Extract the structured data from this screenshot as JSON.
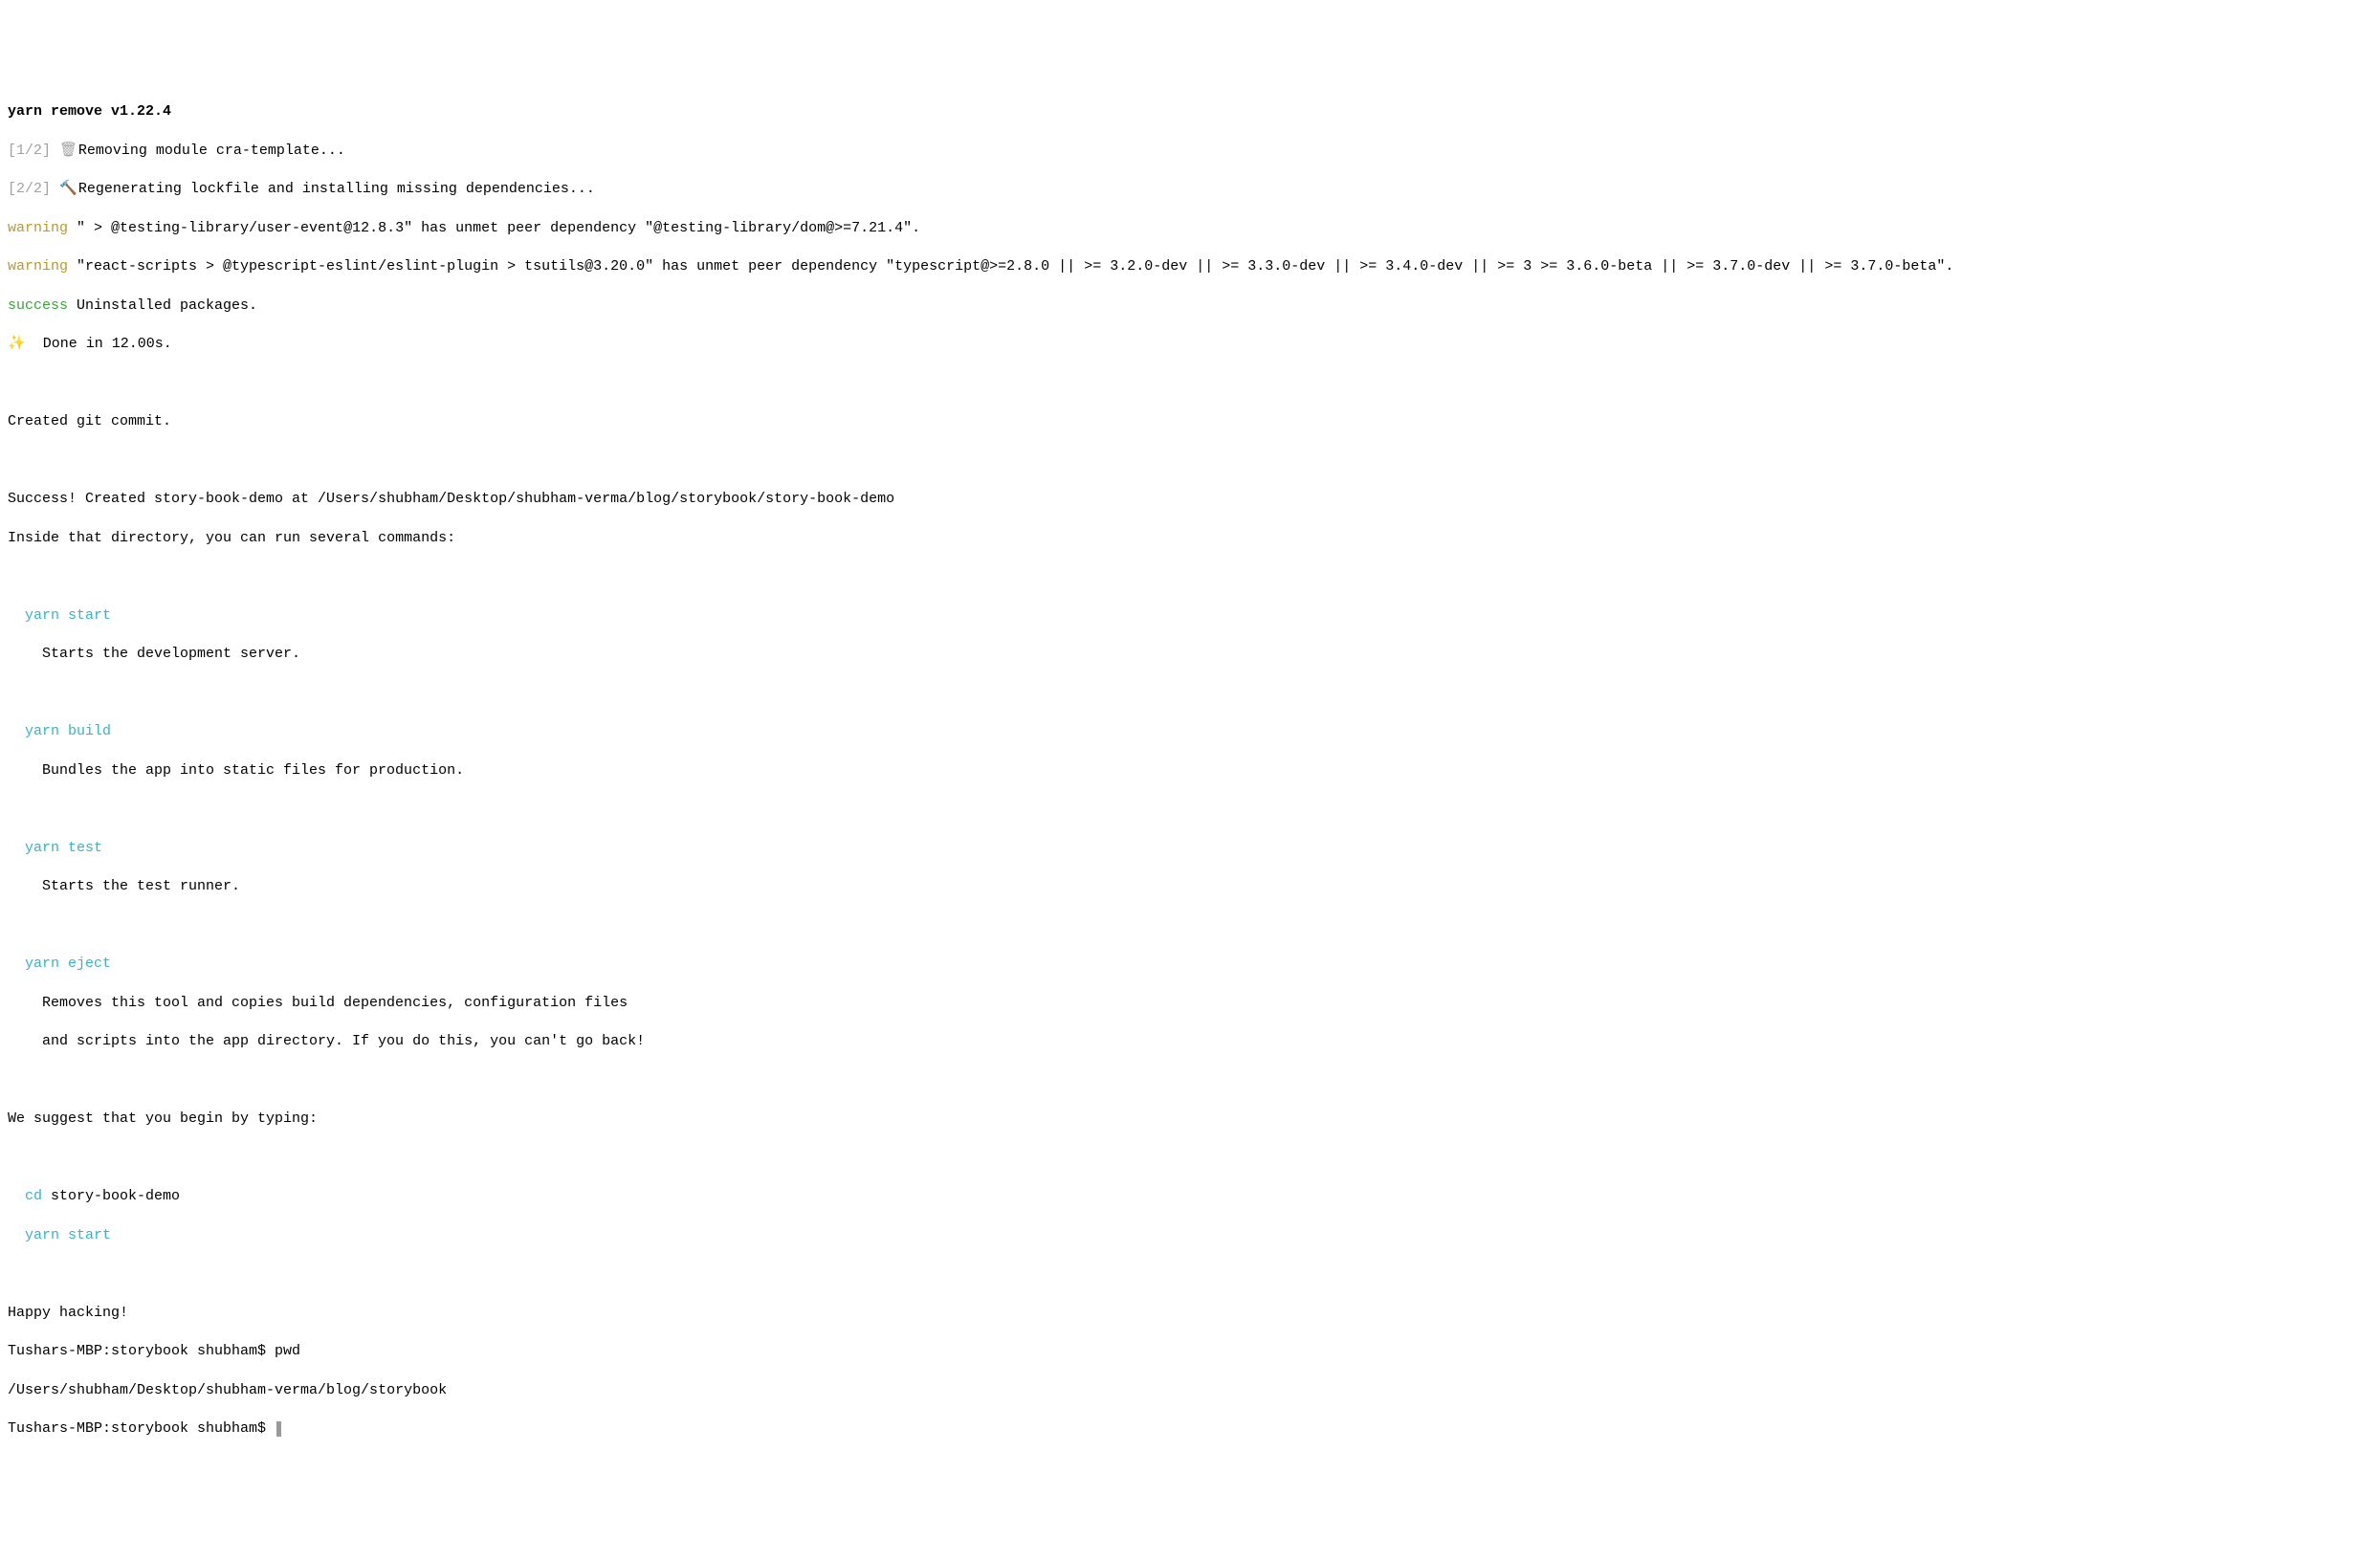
{
  "header": "yarn remove v1.22.4",
  "steps": [
    {
      "num": "[1/2]",
      "icon": "🗑",
      "text": " Removing module cra-template..."
    },
    {
      "num": "[2/2]",
      "icon": "🔨",
      "text": " Regenerating lockfile and installing missing dependencies..."
    }
  ],
  "warnings": [
    {
      "label": "warning",
      "text": " \" > @testing-library/user-event@12.8.3\" has unmet peer dependency \"@testing-library/dom@>=7.21.4\"."
    },
    {
      "label": "warning",
      "text": " \"react-scripts > @typescript-eslint/eslint-plugin > tsutils@3.20.0\" has unmet peer dependency \"typescript@>=2.8.0 || >= 3.2.0-dev || >= 3.3.0-dev || >= 3.4.0-dev || >= 3 >= 3.6.0-beta || >= 3.7.0-dev || >= 3.7.0-beta\"."
    }
  ],
  "successLine": {
    "label": "success",
    "text": " Uninstalled packages."
  },
  "doneLine": {
    "icon": "✨",
    "text": "  Done in 12.00s."
  },
  "gitCommit": "Created git commit.",
  "createdSuccess": "Success! Created story-book-demo at /Users/shubham/Desktop/shubham-verma/blog/storybook/story-book-demo",
  "insideDir": "Inside that directory, you can run several commands:",
  "commands": [
    {
      "name": "yarn start",
      "desc": [
        "Starts the development server."
      ]
    },
    {
      "name": "yarn build",
      "desc": [
        "Bundles the app into static files for production."
      ]
    },
    {
      "name": "yarn test",
      "desc": [
        "Starts the test runner."
      ]
    },
    {
      "name": "yarn eject",
      "desc": [
        "Removes this tool and copies build dependencies, configuration files",
        "and scripts into the app directory. If you do this, you can't go back!"
      ]
    }
  ],
  "suggest": "We suggest that you begin by typing:",
  "beginCd": {
    "cmd": "cd",
    "arg": " story-book-demo"
  },
  "beginStart": "yarn start",
  "happy": "Happy hacking!",
  "prompt1": {
    "ps": "Tushars-MBP:storybook shubham$ ",
    "cmd": "pwd"
  },
  "pwdOut": "/Users/shubham/Desktop/shubham-verma/blog/storybook",
  "prompt2": {
    "ps": "Tushars-MBP:storybook shubham$ "
  }
}
